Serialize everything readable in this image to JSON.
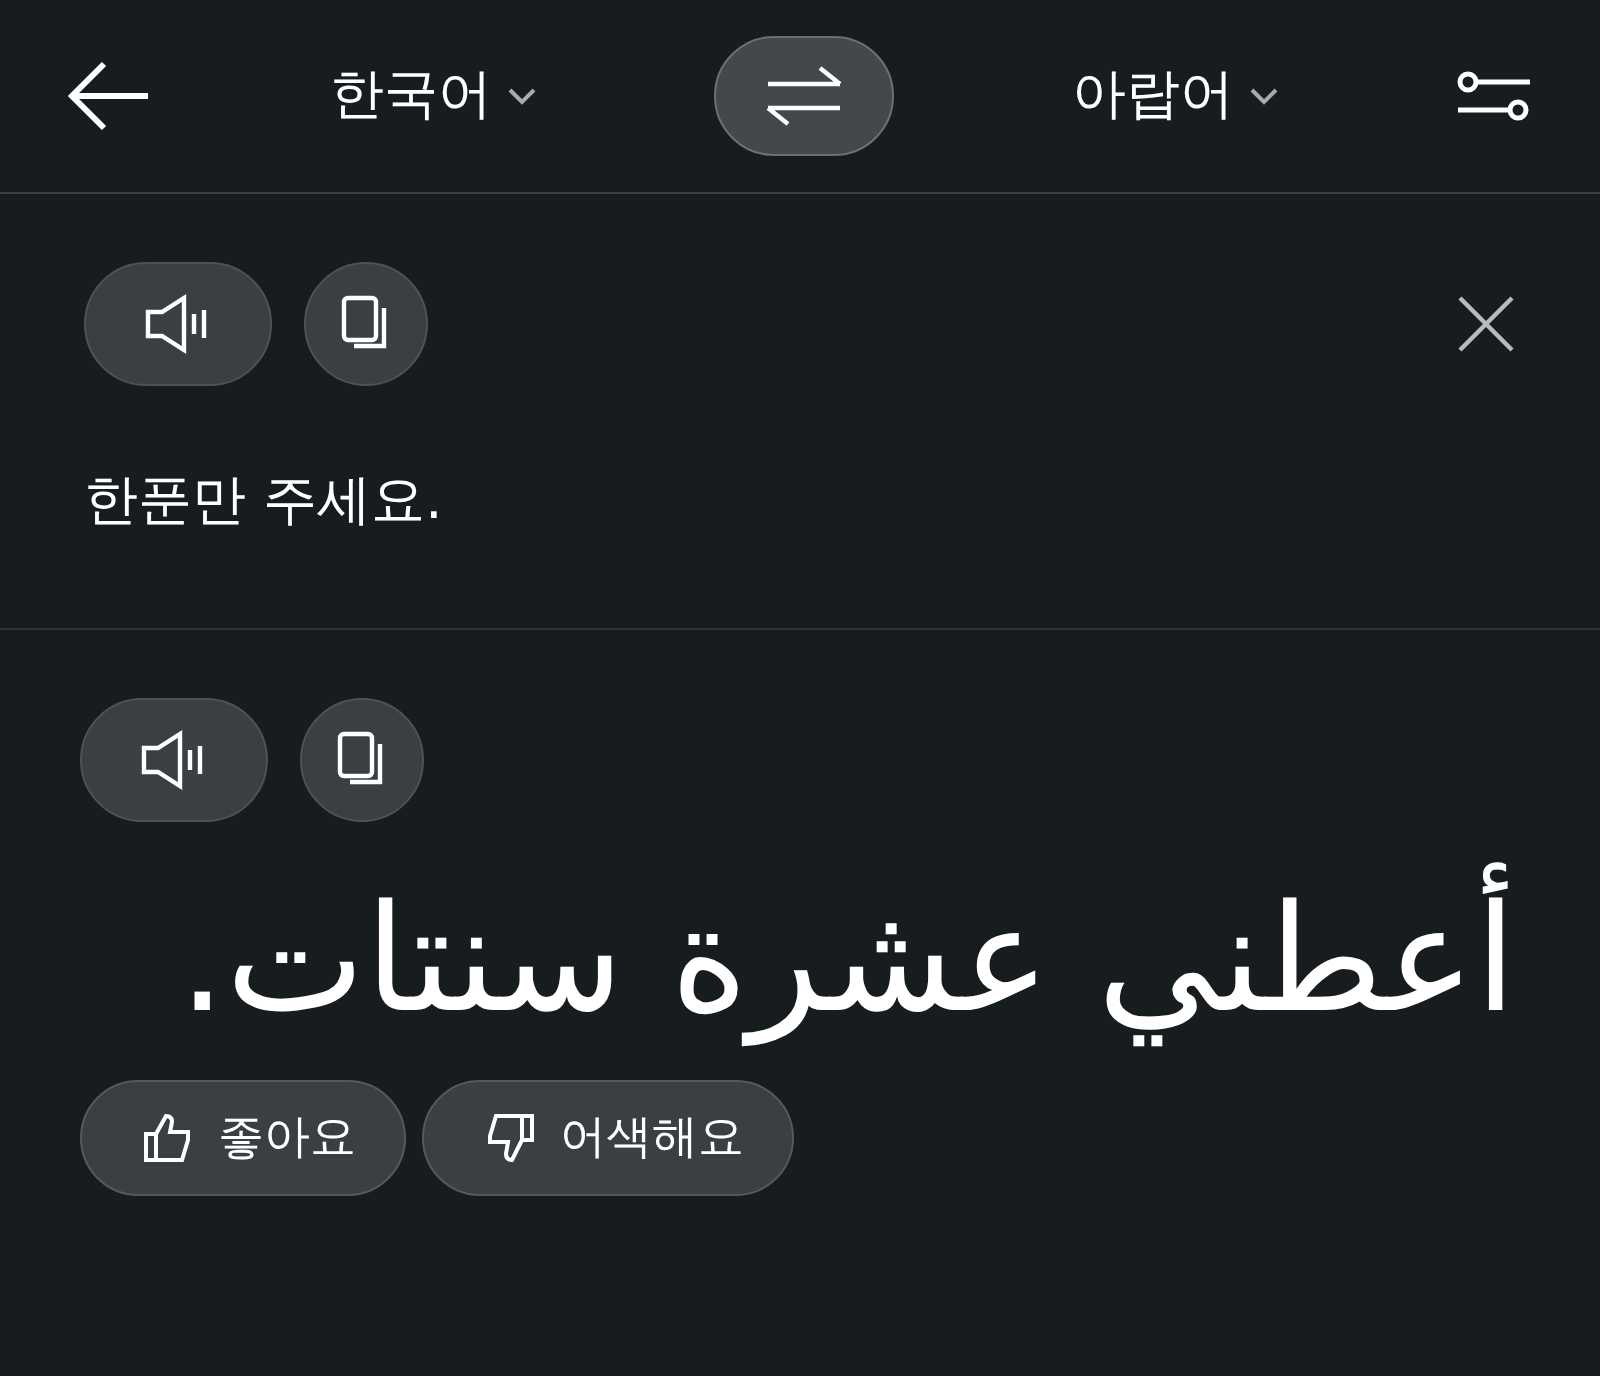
{
  "header": {
    "source_language": "한국어",
    "target_language": "아랍어"
  },
  "source": {
    "text": "한푼만 주세요."
  },
  "translation": {
    "text": "أعطني عشرة سنتات."
  },
  "feedback": [
    {
      "kind": "like",
      "label": "좋아요"
    },
    {
      "kind": "dislike",
      "label": "어색해요"
    }
  ]
}
